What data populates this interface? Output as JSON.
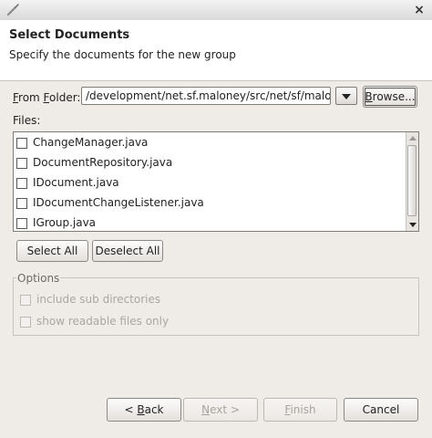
{
  "window": {
    "close_glyph": "×",
    "icon": "wizard-icon"
  },
  "header": {
    "title": "Select Documents",
    "description": "Specify the documents for the new group"
  },
  "folder": {
    "label_mnemonic": "F",
    "label_rest": "rom ",
    "label_mnemonic2": "F",
    "label_end": "older:",
    "value": "/development/net.sf.maloney/src/net/sf/maloney"
  },
  "browse_button": {
    "mnemonic": "B",
    "rest": "rowse..."
  },
  "files": {
    "label": "Files:",
    "items": [
      {
        "name": "ChangeManager.java",
        "checked": false
      },
      {
        "name": "DocumentRepository.java",
        "checked": false
      },
      {
        "name": "IDocument.java",
        "checked": false
      },
      {
        "name": "IDocumentChangeListener.java",
        "checked": false
      },
      {
        "name": "IGroup.java",
        "checked": false
      }
    ]
  },
  "select_buttons": {
    "select_all": "Select All",
    "deselect_all": "Deselect All"
  },
  "options": {
    "legend": "Options",
    "include_sub_directories": "include sub directories",
    "show_readable_only": "show readable files only"
  },
  "nav_buttons": {
    "back_prefix": "< ",
    "back_mnemonic": "B",
    "back_rest": "ack",
    "next_mnemonic": "N",
    "next_rest": "ext >",
    "finish_mnemonic": "F",
    "finish_rest": "inish",
    "cancel": "Cancel"
  }
}
